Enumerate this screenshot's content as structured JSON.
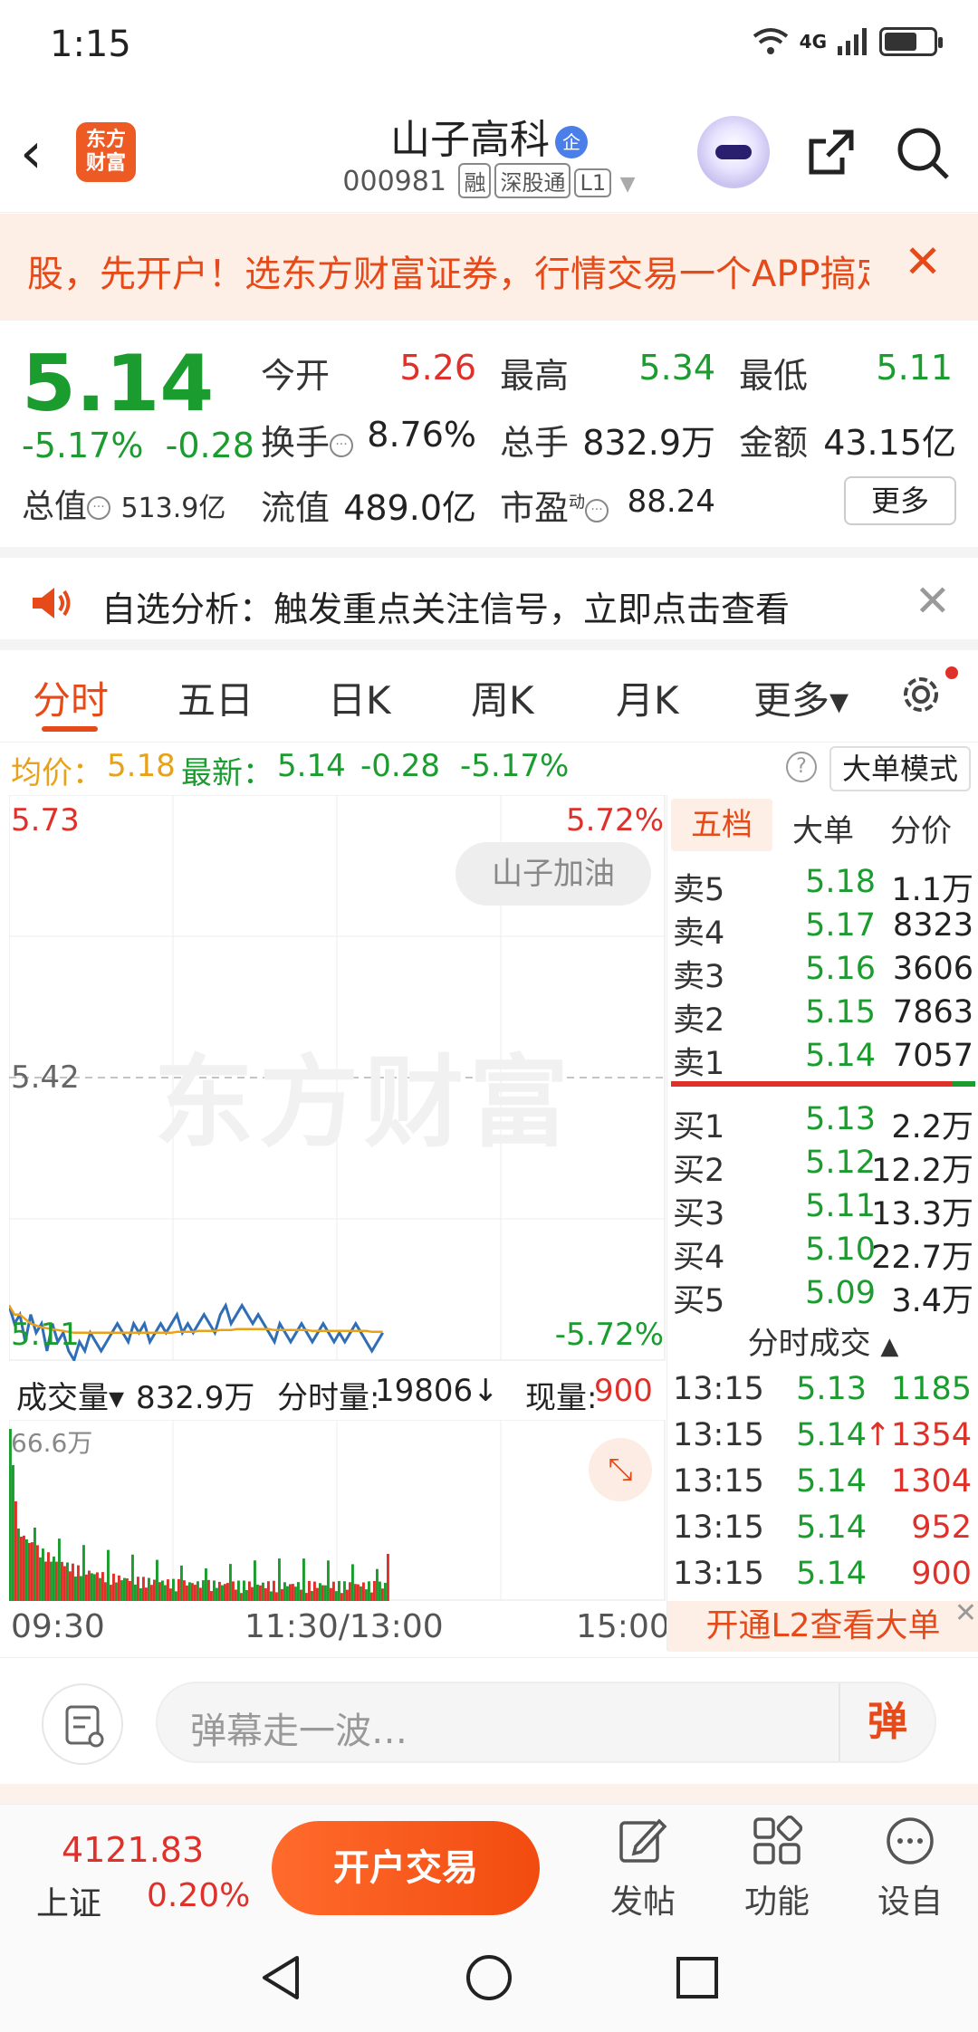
{
  "status_bar": {
    "time": "1:15",
    "network": "4G"
  },
  "header": {
    "back": "‹",
    "logo_text": "东方财富",
    "stock_name": "山子高科",
    "qi_badge": "企",
    "code": "000981",
    "tags": [
      "融",
      "深股通",
      "L1"
    ]
  },
  "banner": {
    "text": "股，先开户！选东方财富证券，行情交易一个APP搞定",
    "close": "✕"
  },
  "quote": {
    "price": "5.14",
    "change_pct": "-5.17%",
    "change": "-0.28",
    "total_value_label": "总值",
    "total_value": "513.9亿",
    "open_label": "今开",
    "open": "5.26",
    "high_label": "最高",
    "high": "5.34",
    "low_label": "最低",
    "low": "5.11",
    "turnover_label": "换手",
    "turnover": "8.76%",
    "volume_label": "总手",
    "volume": "832.9万",
    "amount_label": "金额",
    "amount": "43.15亿",
    "float_label": "流值",
    "float_value": "489.0亿",
    "pe_label": "市盈",
    "pe_sup": "动",
    "pe": "88.24",
    "more": "更多"
  },
  "notice": {
    "text": "自选分析：触发重点关注信号，立即点击查看",
    "close": "✕"
  },
  "tabs": [
    "分时",
    "五日",
    "日K",
    "周K",
    "月K",
    "更多▾"
  ],
  "avg_row": {
    "avg_label": "均价：",
    "avg": "5.18",
    "latest_label": "最新：",
    "latest": "5.14",
    "chg": "-0.28",
    "pct": "-5.17%",
    "help": "?",
    "mode": "大单模式"
  },
  "chart": {
    "top_price": "5.73",
    "top_pct": "5.72%",
    "mid_price": "5.42",
    "bottom_price": "5.11",
    "bottom_pct": "-5.72%",
    "pill": "山子加油",
    "watermark": "东方财富",
    "vol_max": "66.6万"
  },
  "chart_data": {
    "type": "line",
    "ylim": [
      5.11,
      5.73
    ],
    "series": [
      {
        "name": "价格",
        "values": [
          5.17,
          5.15,
          5.16,
          5.13,
          5.16,
          5.14,
          5.15,
          5.12,
          5.15,
          5.13,
          5.14,
          5.12,
          5.11,
          5.13,
          5.12,
          5.14,
          5.13,
          5.12,
          5.13,
          5.14,
          5.15,
          5.14,
          5.13,
          5.15,
          5.14,
          5.15,
          5.13,
          5.14,
          5.15,
          5.14,
          5.15,
          5.16,
          5.14,
          5.15,
          5.14,
          5.15,
          5.16,
          5.15,
          5.14,
          5.16,
          5.17,
          5.15,
          5.16,
          5.17,
          5.16,
          5.15,
          5.16,
          5.15,
          5.14,
          5.13,
          5.15,
          5.14,
          5.13,
          5.14,
          5.15,
          5.14,
          5.13,
          5.14,
          5.15,
          5.14,
          5.13,
          5.14,
          5.13,
          5.14,
          5.15,
          5.14,
          5.13,
          5.12,
          5.13,
          5.14
        ]
      },
      {
        "name": "均价",
        "values": [
          5.17,
          5.16,
          5.16,
          5.155,
          5.15,
          5.148,
          5.146,
          5.145,
          5.144,
          5.143,
          5.142,
          5.141,
          5.14,
          5.14,
          5.14,
          5.14,
          5.14,
          5.14,
          5.14,
          5.14,
          5.14,
          5.14,
          5.14,
          5.14,
          5.14,
          5.14,
          5.14,
          5.14,
          5.14,
          5.14,
          5.14,
          5.141,
          5.141,
          5.141,
          5.141,
          5.142,
          5.142,
          5.142,
          5.142,
          5.143,
          5.143,
          5.143,
          5.144,
          5.144,
          5.144,
          5.144,
          5.144,
          5.144,
          5.144,
          5.143,
          5.143,
          5.143,
          5.143,
          5.143,
          5.143,
          5.143,
          5.142,
          5.142,
          5.142,
          5.142,
          5.142,
          5.142,
          5.142,
          5.142,
          5.142,
          5.142,
          5.142,
          5.141,
          5.141,
          5.141
        ]
      }
    ]
  },
  "vol_row": {
    "label": "成交量▾",
    "total": "832.9万",
    "minute_label": "分时量:",
    "minute": "19806↓",
    "now_label": "现量:",
    "now": "900"
  },
  "time_axis": [
    "09:30",
    "11:30/13:00",
    "15:00"
  ],
  "book": {
    "tabs": [
      "五档",
      "大单",
      "分价"
    ],
    "sells": [
      {
        "l": "卖5",
        "p": "5.18",
        "v": "1.1万"
      },
      {
        "l": "卖4",
        "p": "5.17",
        "v": "8323"
      },
      {
        "l": "卖3",
        "p": "5.16",
        "v": "3606"
      },
      {
        "l": "卖2",
        "p": "5.15",
        "v": "7863"
      },
      {
        "l": "卖1",
        "p": "5.14",
        "v": "7057"
      }
    ],
    "buys": [
      {
        "l": "买1",
        "p": "5.13",
        "v": "2.2万"
      },
      {
        "l": "买2",
        "p": "5.12",
        "v": "12.2万"
      },
      {
        "l": "买3",
        "p": "5.11",
        "v": "13.3万"
      },
      {
        "l": "买4",
        "p": "5.10",
        "v": "22.7万"
      },
      {
        "l": "买5",
        "p": "5.09",
        "v": "3.4万"
      }
    ],
    "ticks_title": "分时成交",
    "ticks": [
      {
        "t": "13:15",
        "p": "5.13",
        "v": "1185",
        "c": "#1a9c2e"
      },
      {
        "t": "13:15",
        "p": "5.14",
        "v": "1354",
        "c": "#e0302a",
        "arrow": "↑"
      },
      {
        "t": "13:15",
        "p": "5.14",
        "v": "1304",
        "c": "#e0302a"
      },
      {
        "t": "13:15",
        "p": "5.14",
        "v": "952",
        "c": "#e0302a"
      },
      {
        "t": "13:15",
        "p": "5.14",
        "v": "900",
        "c": "#e0302a"
      }
    ],
    "l2": "开通L2查看大单"
  },
  "danmu": {
    "placeholder": "弹幕走一波…",
    "btn": "弹"
  },
  "bottom": {
    "index_value": "4121.83",
    "index_name": "上证",
    "index_pct": "0.20%",
    "trade": "开户交易",
    "nav": [
      "发帖",
      "功能",
      "设自选"
    ]
  },
  "colors": {
    "accent": "#e64a19",
    "up": "#e0302a",
    "down": "#1a9c2e",
    "price_line": "#2f6db5",
    "avg_line": "#e8a21a"
  }
}
